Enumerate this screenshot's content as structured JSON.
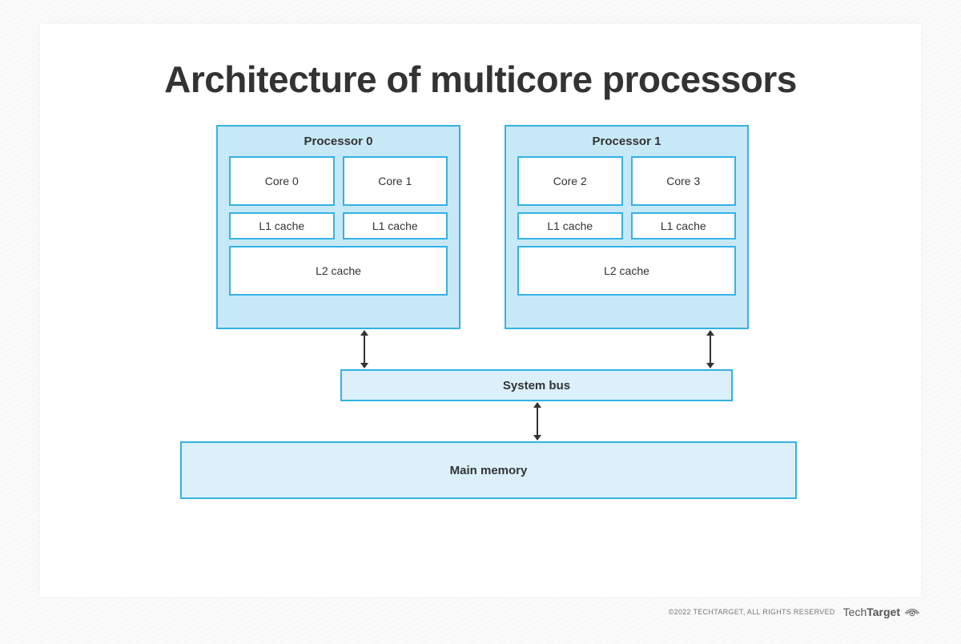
{
  "title": "Architecture of multicore processors",
  "processors": [
    {
      "label": "Processor 0",
      "cores": [
        "Core 0",
        "Core 1"
      ],
      "l1": [
        "L1 cache",
        "L1 cache"
      ],
      "l2": "L2 cache"
    },
    {
      "label": "Processor 1",
      "cores": [
        "Core 2",
        "Core 3"
      ],
      "l1": [
        "L1 cache",
        "L1 cache"
      ],
      "l2": "L2 cache"
    }
  ],
  "bus": "System bus",
  "memory": "Main memory",
  "footer": {
    "copyright": "©2022 TECHTARGET, ALL RIGHTS RESERVED",
    "brand_light": "Tech",
    "brand_bold": "Target"
  },
  "colors": {
    "border": "#34b2e4",
    "fill_light": "#dbf0fa",
    "fill_mid": "#c7e9f7",
    "text": "#333333"
  }
}
